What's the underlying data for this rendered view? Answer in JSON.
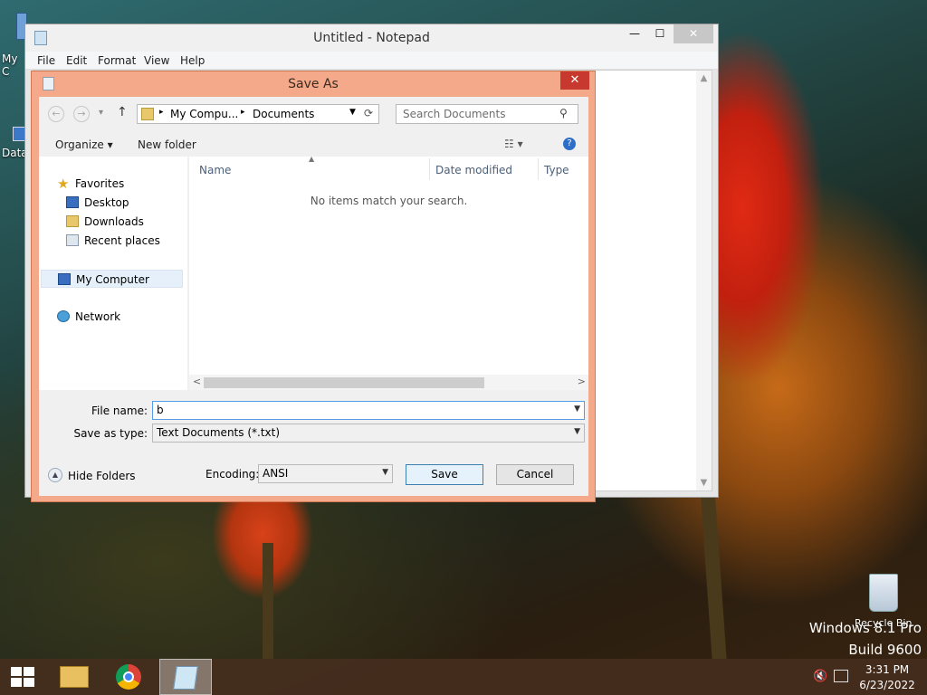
{
  "desktop": {
    "icons": [
      {
        "label": "My C",
        "icon": "computer-icon"
      },
      {
        "label": "Data",
        "icon": "database-icon"
      },
      {
        "label": "Recycle Bin",
        "icon": "recycle-bin-icon"
      }
    ],
    "watermark_line1": "Windows 8.1 Pro",
    "watermark_line2": "Build 9600"
  },
  "notepad": {
    "title": "Untitled - Notepad",
    "menu": [
      "File",
      "Edit",
      "Format",
      "View",
      "Help"
    ],
    "caption": {
      "minimize": "—",
      "maximize": "☐",
      "close": "✕"
    }
  },
  "dialog": {
    "title": "Save As",
    "close_glyph": "✕",
    "nav": {
      "back": "←",
      "forward": "→",
      "recent": "▾",
      "up": "↑"
    },
    "address": {
      "segments": [
        "My Compu...",
        "Documents"
      ],
      "separator": "▸",
      "refresh": "⟳"
    },
    "search": {
      "placeholder": "Search Documents"
    },
    "toolbar": {
      "organize": "Organize ▾",
      "new_folder": "New folder",
      "view_glyph": "☷ ▾",
      "help_glyph": "?"
    },
    "nav_pane": {
      "favorites": "Favorites",
      "desktop": "Desktop",
      "downloads": "Downloads",
      "recent_places": "Recent places",
      "my_computer": "My Computer",
      "network": "Network"
    },
    "columns": {
      "name": "Name",
      "date_modified": "Date modified",
      "type": "Type"
    },
    "empty_message": "No items match your search.",
    "hscroll": {
      "left": "<",
      "right": ">"
    },
    "file_name_label": "File name:",
    "file_name_value": "b",
    "save_as_type_label": "Save as type:",
    "save_as_type_value": "Text Documents (*.txt)",
    "hide_folders": "Hide Folders",
    "encoding_label": "Encoding:",
    "encoding_value": "ANSI",
    "save_button": "Save",
    "cancel_button": "Cancel"
  },
  "taskbar": {
    "items": [
      "start-icon",
      "file-explorer-icon",
      "chrome-icon",
      "notepad-icon"
    ],
    "time": "3:31 PM",
    "date": "6/23/2022"
  },
  "colors": {
    "dialog_frame": "#f4a98a",
    "close_red": "#c7392f",
    "taskbar": "#462d1e"
  }
}
